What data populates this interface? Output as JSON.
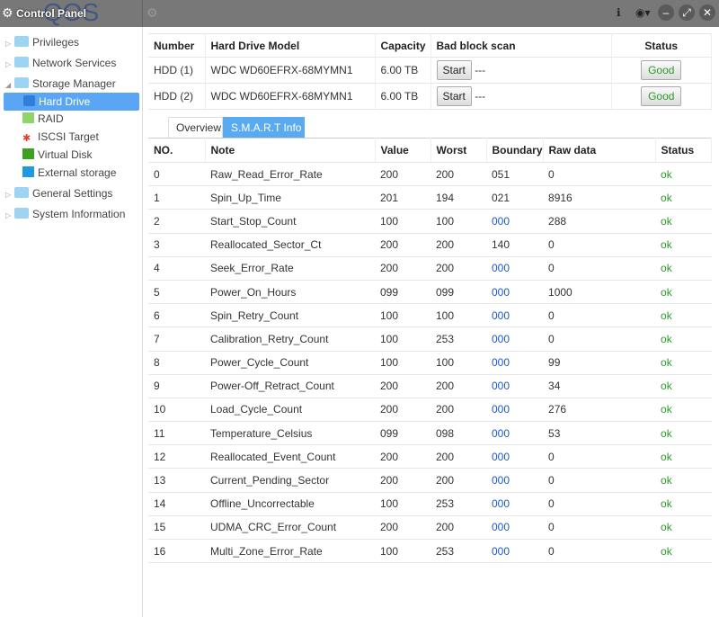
{
  "title": "Control Panel",
  "logo_text": "QOS",
  "sidebar": {
    "items": [
      {
        "label": "Privileges"
      },
      {
        "label": "Network Services"
      },
      {
        "label": "Storage Manager"
      },
      {
        "label": "Hard Drive"
      },
      {
        "label": "RAID"
      },
      {
        "label": "ISCSI Target"
      },
      {
        "label": "Virtual Disk"
      },
      {
        "label": "External storage"
      },
      {
        "label": "General Settings"
      },
      {
        "label": "System Information"
      }
    ]
  },
  "drives": {
    "headers": [
      "Number",
      "Hard Drive Model",
      "Capacity",
      "Bad block scan",
      "Status"
    ],
    "rows": [
      {
        "number": "HDD (1)",
        "model": "WDC WD60EFRX-68MYMN1",
        "capacity": "6.00 TB",
        "scan_button": "Start",
        "scan_status": "---",
        "status": "Good"
      },
      {
        "number": "HDD (2)",
        "model": "WDC WD60EFRX-68MYMN1",
        "capacity": "6.00 TB",
        "scan_button": "Start",
        "scan_status": "---",
        "status": "Good"
      }
    ]
  },
  "tabs": [
    {
      "label": "Overview"
    },
    {
      "label": "S.M.A.R.T Info",
      "active": true
    }
  ],
  "smart": {
    "headers": [
      "NO.",
      "Note",
      "Value",
      "Worst",
      "Boundary",
      "Raw data",
      "Status"
    ],
    "rows": [
      [
        "0",
        "Raw_Read_Error_Rate",
        "200",
        "200",
        "051",
        "0",
        "ok"
      ],
      [
        "1",
        "Spin_Up_Time",
        "201",
        "194",
        "021",
        "8916",
        "ok"
      ],
      [
        "2",
        "Start_Stop_Count",
        "100",
        "100",
        "000",
        "288",
        "ok"
      ],
      [
        "3",
        "Reallocated_Sector_Ct",
        "200",
        "200",
        "140",
        "0",
        "ok"
      ],
      [
        "4",
        "Seek_Error_Rate",
        "200",
        "200",
        "000",
        "0",
        "ok"
      ],
      [
        "5",
        "Power_On_Hours",
        "099",
        "099",
        "000",
        "1000",
        "ok"
      ],
      [
        "6",
        "Spin_Retry_Count",
        "100",
        "100",
        "000",
        "0",
        "ok"
      ],
      [
        "7",
        "Calibration_Retry_Count",
        "100",
        "253",
        "000",
        "0",
        "ok"
      ],
      [
        "8",
        "Power_Cycle_Count",
        "100",
        "100",
        "000",
        "99",
        "ok"
      ],
      [
        "9",
        "Power-Off_Retract_Count",
        "200",
        "200",
        "000",
        "34",
        "ok"
      ],
      [
        "10",
        "Load_Cycle_Count",
        "200",
        "200",
        "000",
        "276",
        "ok"
      ],
      [
        "11",
        "Temperature_Celsius",
        "099",
        "098",
        "000",
        "53",
        "ok"
      ],
      [
        "12",
        "Reallocated_Event_Count",
        "200",
        "200",
        "000",
        "0",
        "ok"
      ],
      [
        "13",
        "Current_Pending_Sector",
        "200",
        "200",
        "000",
        "0",
        "ok"
      ],
      [
        "14",
        "Offline_Uncorrectable",
        "100",
        "253",
        "000",
        "0",
        "ok"
      ],
      [
        "15",
        "UDMA_CRC_Error_Count",
        "200",
        "200",
        "000",
        "0",
        "ok"
      ],
      [
        "16",
        "Multi_Zone_Error_Rate",
        "100",
        "253",
        "000",
        "0",
        "ok"
      ]
    ]
  },
  "colors": {
    "accent": "#5aa6f5",
    "ok": "#2a9a2a",
    "boundary_zero": "#1b58c8"
  }
}
